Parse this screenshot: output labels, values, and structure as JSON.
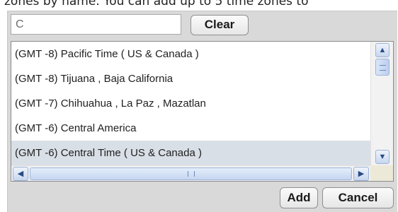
{
  "instruction": "zones by name. You can add up to 5 time zones to",
  "search": {
    "value": "C",
    "placeholder": ""
  },
  "buttons": {
    "clear": "Clear",
    "add": "Add",
    "cancel": "Cancel"
  },
  "list": {
    "items": [
      {
        "label": "(GMT -8) Pacific Time ( US & Canada )",
        "selected": false
      },
      {
        "label": "(GMT -8) Tijuana , Baja California",
        "selected": false
      },
      {
        "label": "(GMT -7) Chihuahua , La Paz , Mazatlan",
        "selected": false
      },
      {
        "label": "(GMT -6) Central America",
        "selected": false
      },
      {
        "label": "(GMT -6) Central Time ( US & Canada )",
        "selected": true
      }
    ]
  },
  "scrollbar_icons": {
    "up": "arrow-up-icon",
    "down": "arrow-down-icon",
    "left": "arrow-left-icon",
    "right": "arrow-right-icon"
  },
  "colors": {
    "panel": "#d9d9d9",
    "selected_row": "#d9dfe6",
    "scrollbar_accent": "#9eb3d6"
  }
}
